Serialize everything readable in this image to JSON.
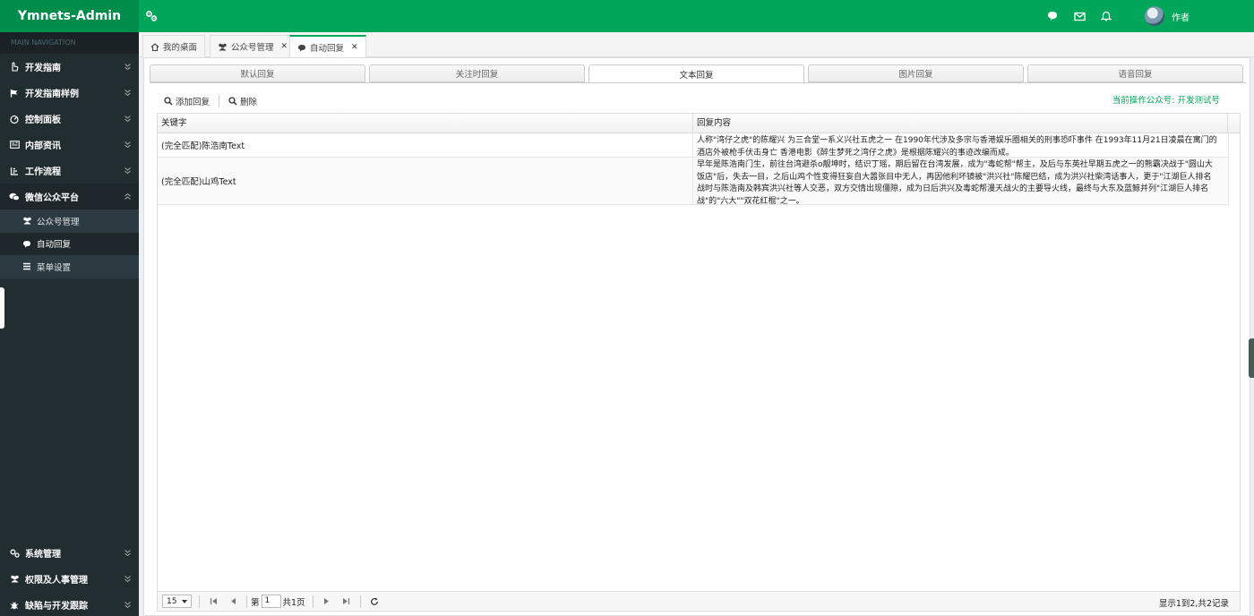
{
  "app": {
    "title": "Ymnets-Admin"
  },
  "header": {
    "icons": [
      "comments-icon",
      "envelope-icon",
      "bell-icon"
    ],
    "user_name": "作者"
  },
  "sidebar": {
    "nav_header": "MAIN NAVIGATION",
    "items": [
      {
        "label": "开发指南",
        "icon": "hand-icon"
      },
      {
        "label": "开发指南样例",
        "icon": "flag-icon"
      },
      {
        "label": "控制面板",
        "icon": "dashboard-icon"
      },
      {
        "label": "内部资讯",
        "icon": "newspaper-icon"
      },
      {
        "label": "工作流程",
        "icon": "flow-icon"
      },
      {
        "label": "微信公众平台",
        "icon": "wechat-icon"
      }
    ],
    "subitems": [
      {
        "label": "公众号管理",
        "icon": "users-icon"
      },
      {
        "label": "自动回复",
        "icon": "comment-icon"
      },
      {
        "label": "菜单设置",
        "icon": "list-icon"
      }
    ],
    "bottom_items": [
      {
        "label": "系统管理",
        "icon": "cogs-icon"
      },
      {
        "label": "权限及人事管理",
        "icon": "users-icon"
      },
      {
        "label": "缺陷与开发跟踪",
        "icon": "bug-icon"
      }
    ]
  },
  "page_tabs": [
    {
      "label": "我的桌面"
    },
    {
      "label": "公众号管理"
    },
    {
      "label": "自动回复"
    }
  ],
  "reply_tabs": [
    "默认回复",
    "关注时回复",
    "文本回复",
    "图片回复",
    "语音回复"
  ],
  "toolbar": {
    "add_label": "添加回复",
    "delete_label": "删除"
  },
  "account_label": "当前操作公众号: 开发测试号",
  "table": {
    "columns": [
      "关键字",
      "回复内容"
    ],
    "rows": [
      {
        "keyword": "(完全匹配)陈浩南Text",
        "content": "人称\"湾仔之虎\"的陈耀兴 为三合堂一系义兴社五虎之一 在1990年代涉及多宗与香港娱乐圈相关的刑事恐吓事件 在1993年11月21日凌晨在寓门的酒店外被枪手伏击身亡 香港电影《醉生梦死之湾仔之虎》是根据陈耀兴的事迹改编而成。"
      },
      {
        "keyword": "(完全匹配)山鸡Text",
        "content": "早年是陈浩南门生，前往台湾避杀o靓坤时，结识丁瑶，期后留在台湾发展，成为\"毒蛇帮\"帮主，及后与东英社早期五虎之一的熊霸决战于\"圆山大饭店\"后，失去一目，之后山鸡个性变得狂妄自大嚣张目中无人，再因他利坏镜被\"洪兴社\"陈耀巴结，成为洪兴社柴湾话事人，更于\"江湖巨人排名战时与陈浩南及韩宾洪兴社等人交恶，双方交情出现僵隙，成为日后洪兴及毒蛇帮漫天战火的主要导火线，最终与大东及蓝鲸并列\"江湖巨人排名战\"的\"六大\"\"双花红棍\"之一。"
      }
    ]
  },
  "pager": {
    "page_size": "15",
    "page_prefix": "第",
    "page_value": "1",
    "page_suffix": "共1页",
    "info": "显示1到2,共2记录"
  }
}
